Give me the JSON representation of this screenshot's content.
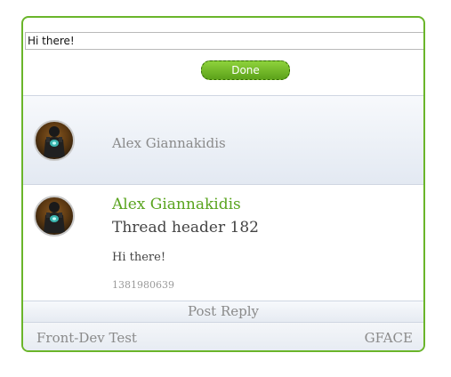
{
  "reply": {
    "input_value": "Hi there!",
    "done_label": "Done"
  },
  "thread_header": {
    "author": "Alex Giannakidis",
    "avatar_icon": "user-avatar-icon"
  },
  "post": {
    "author": "Alex Giannakidis",
    "title": "Thread header 182",
    "body": "Hi there!",
    "timestamp": "1381980639",
    "avatar_icon": "user-avatar-icon"
  },
  "actions": {
    "post_reply_label": "Post Reply"
  },
  "footer": {
    "left": "Front-Dev Test",
    "right": "GFACE"
  },
  "colors": {
    "accent": "#6ab52a",
    "author_green": "#5aa41f",
    "muted_text": "#8a8a8a"
  }
}
